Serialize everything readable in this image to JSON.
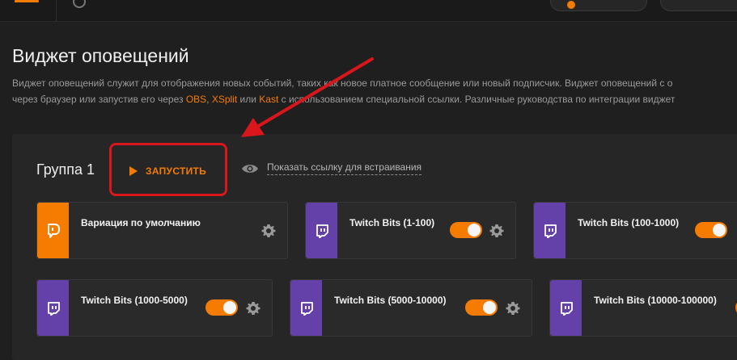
{
  "page": {
    "title": "Виджет оповещений",
    "description_line1": "Виджет оповещений служит для отображения новых событий, таких как новое платное сообщение или новый подписчик. Виджет оповещений с о",
    "description_line2_before": "через браузер или запустив его через ",
    "link_obs": "OBS",
    "sep1": ", ",
    "link_xsplit": "XSplit",
    "sep2": " или ",
    "link_kast": "Kast",
    "description_line2_after": " с использованием специальной ссылки. Различные руководства по интеграции виджет"
  },
  "group": {
    "title": "Группа 1",
    "run_label": "ЗАПУСТИТЬ",
    "embed_label": "Показать ссылку для встраивания"
  },
  "cards": [
    {
      "name": "Вариация по умолчанию",
      "icon": "donationalerts-icon",
      "stripe_color": "#f57c00",
      "toggle": null
    },
    {
      "name": "Twitch Bits (1-100)",
      "icon": "twitch-icon",
      "stripe_color": "#6341a8",
      "toggle": true
    },
    {
      "name": "Twitch Bits (100-1000)",
      "icon": "twitch-icon",
      "stripe_color": "#6341a8",
      "toggle": true
    },
    {
      "name": "Twitch Bits (1000-5000)",
      "icon": "twitch-icon",
      "stripe_color": "#6341a8",
      "toggle": true
    },
    {
      "name": "Twitch Bits (5000-10000)",
      "icon": "twitch-icon",
      "stripe_color": "#6341a8",
      "toggle": true
    },
    {
      "name": "Twitch Bits (10000-100000)",
      "icon": "twitch-icon",
      "stripe_color": "#6341a8",
      "toggle": true
    }
  ],
  "colors": {
    "accent": "#f57c00",
    "twitch": "#6341a8",
    "annotation": "#d8161b"
  }
}
